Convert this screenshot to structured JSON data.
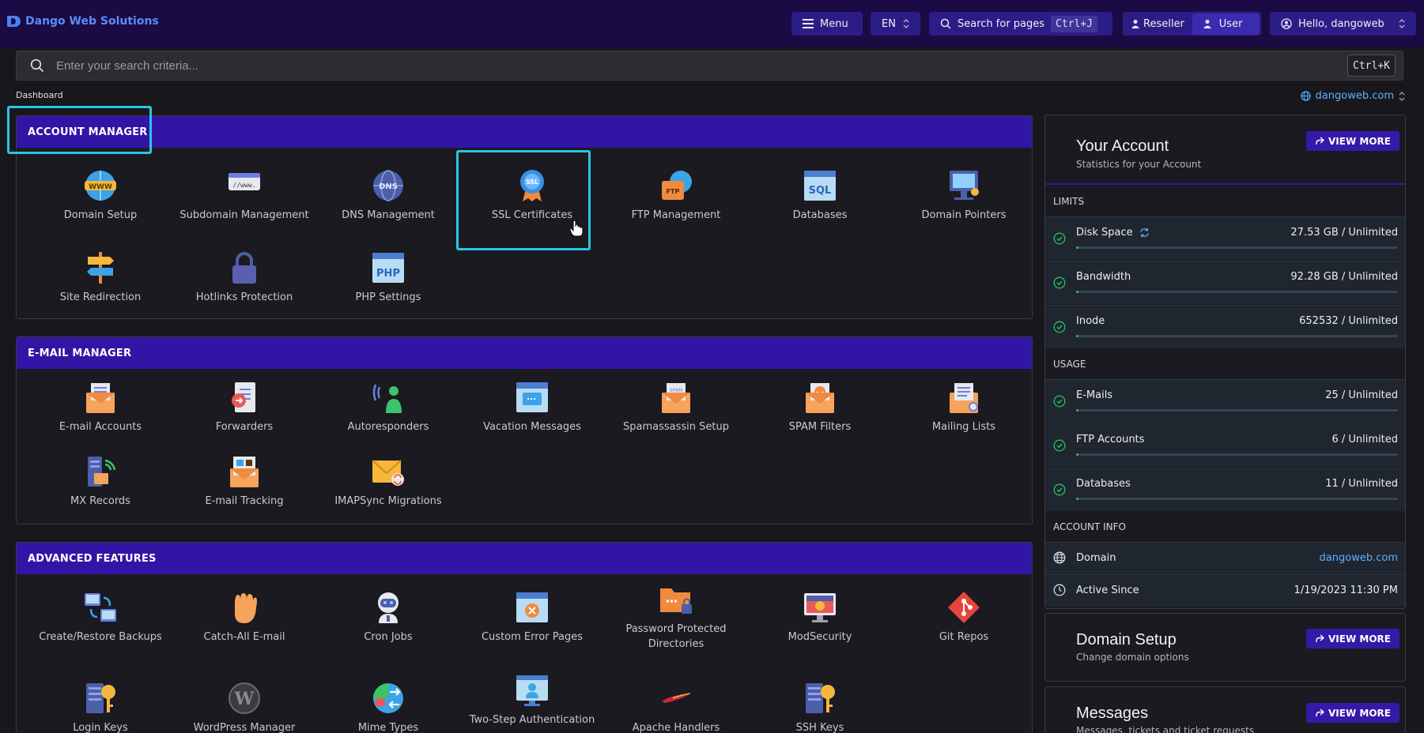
{
  "brand": "Dango Web Solutions",
  "topbar": {
    "menu_label": "Menu",
    "lang": "EN",
    "search_pages_label": "Search for pages",
    "search_pages_shortcut": "Ctrl+J",
    "reseller_label": "Reseller",
    "user_label": "User",
    "hello_label": "Hello, dangoweb"
  },
  "search": {
    "placeholder": "Enter your search criteria...",
    "shortcut": "Ctrl+K"
  },
  "breadcrumb": "Dashboard",
  "domain_selector": "dangoweb.com",
  "account_manager": {
    "title": "ACCOUNT MANAGER",
    "items": [
      {
        "label": "Domain Setup",
        "icon": "www-globe-icon"
      },
      {
        "label": "Subdomain Management",
        "icon": "subdomain-icon"
      },
      {
        "label": "DNS Management",
        "icon": "dns-globe-icon"
      },
      {
        "label": "SSL Certificates",
        "icon": "ssl-badge-icon"
      },
      {
        "label": "FTP Management",
        "icon": "ftp-folder-icon"
      },
      {
        "label": "Databases",
        "icon": "sql-window-icon"
      },
      {
        "label": "Domain Pointers",
        "icon": "domain-pointer-icon"
      },
      {
        "label": "Site Redirection",
        "icon": "signpost-icon"
      },
      {
        "label": "Hotlinks Protection",
        "icon": "padlock-icon"
      },
      {
        "label": "PHP Settings",
        "icon": "php-window-icon"
      }
    ]
  },
  "email_manager": {
    "title": "E-MAIL MANAGER",
    "items": [
      {
        "label": "E-mail Accounts",
        "icon": "email-envelope-icon"
      },
      {
        "label": "Forwarders",
        "icon": "forwarder-icon"
      },
      {
        "label": "Autoresponders",
        "icon": "autoresponder-icon"
      },
      {
        "label": "Vacation Messages",
        "icon": "vacation-message-icon"
      },
      {
        "label": "Spamassassin Setup",
        "icon": "spamassassin-icon"
      },
      {
        "label": "SPAM Filters",
        "icon": "spam-filter-icon"
      },
      {
        "label": "Mailing Lists",
        "icon": "mailing-list-icon"
      },
      {
        "label": "MX Records",
        "icon": "mx-records-icon"
      },
      {
        "label": "E-mail Tracking",
        "icon": "email-tracking-icon"
      },
      {
        "label": "IMAPSync Migrations",
        "icon": "imapsync-icon"
      }
    ]
  },
  "advanced_features": {
    "title": "ADVANCED FEATURES",
    "items": [
      {
        "label": "Create/Restore Backups",
        "icon": "backup-icon"
      },
      {
        "label": "Catch-All E-mail",
        "icon": "catch-all-hand-icon"
      },
      {
        "label": "Cron Jobs",
        "icon": "cron-robot-icon"
      },
      {
        "label": "Custom Error Pages",
        "icon": "error-page-icon"
      },
      {
        "label": "Password Protected Directories",
        "icon": "protected-folder-icon"
      },
      {
        "label": "ModSecurity",
        "icon": "modsecurity-icon"
      },
      {
        "label": "Git Repos",
        "icon": "git-icon"
      },
      {
        "label": "Login Keys",
        "icon": "login-keys-icon"
      },
      {
        "label": "WordPress Manager",
        "icon": "wordpress-icon"
      },
      {
        "label": "Mime Types",
        "icon": "mime-types-icon"
      },
      {
        "label": "Two-Step Authentication",
        "icon": "two-step-icon"
      },
      {
        "label": "Apache Handlers",
        "icon": "apache-feather-icon"
      },
      {
        "label": "SSH Keys",
        "icon": "ssh-keys-icon"
      }
    ]
  },
  "your_account": {
    "title": "Your Account",
    "subtitle": "Statistics for your Account",
    "view_more": "VIEW MORE",
    "limits_title": "LIMITS",
    "limits": [
      {
        "label": "Disk Space",
        "value": "27.53 GB / Unlimited",
        "has_refresh": true
      },
      {
        "label": "Bandwidth",
        "value": "92.28 GB / Unlimited"
      },
      {
        "label": "Inode",
        "value": "652532 / Unlimited"
      }
    ],
    "usage_title": "USAGE",
    "usage": [
      {
        "label": "E-Mails",
        "value": "25 / Unlimited"
      },
      {
        "label": "FTP Accounts",
        "value": "6 / Unlimited"
      },
      {
        "label": "Databases",
        "value": "11 / Unlimited"
      }
    ],
    "info_title": "ACCOUNT INFO",
    "info": [
      {
        "label": "Domain",
        "value": "dangoweb.com"
      },
      {
        "label": "Active Since",
        "value": "1/19/2023 11:30 PM"
      }
    ]
  },
  "domain_setup_card": {
    "title": "Domain Setup",
    "subtitle": "Change domain options",
    "view_more": "VIEW MORE"
  },
  "messages_card": {
    "title": "Messages",
    "subtitle": "Messages, tickets and ticket requests",
    "view_more": "VIEW MORE"
  },
  "colors": {
    "topbar": "#1a0b45",
    "accent": "#3116a6",
    "highlight": "#28c6e6",
    "link": "#5fb0ff",
    "ok": "#22c55e"
  }
}
